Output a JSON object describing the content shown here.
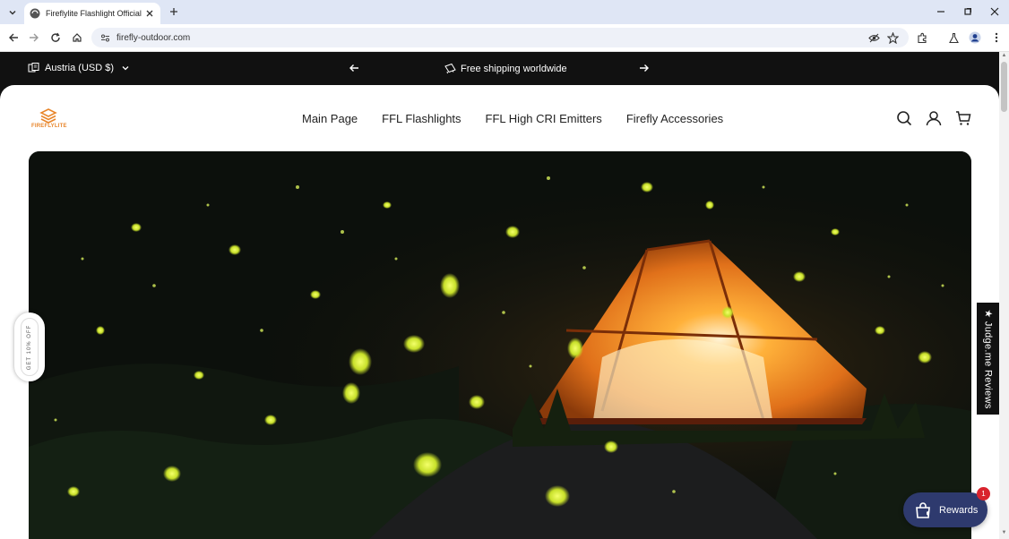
{
  "browser": {
    "tab_title": "Fireflylite Flashlight Official Store",
    "url": "firefly-outdoor.com"
  },
  "announcement": {
    "country": "Austria (USD $)",
    "message": "Free shipping worldwide"
  },
  "header": {
    "logo_text": "FIREFLYLITE",
    "nav": [
      "Main Page",
      "FFL Flashlights",
      "FFL High CRI Emitters",
      "Firefly Accessories"
    ]
  },
  "widgets": {
    "discount_tab": "GET 10% OFF",
    "reviews_tab": "★ Judge.me Reviews",
    "rewards_label": "Rewards",
    "rewards_badge": "1"
  },
  "colors": {
    "brand": "#e8862b",
    "announcement_bg": "#111111",
    "rewards_bg": "#2e3a6e",
    "badge": "#d9232d",
    "tabbar": "#dfe6f5"
  }
}
